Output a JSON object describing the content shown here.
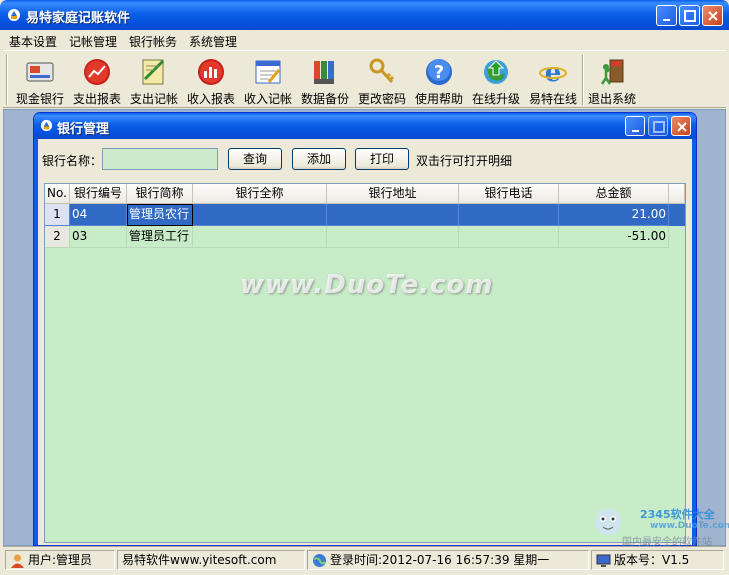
{
  "app": {
    "title": "易特家庭记账软件",
    "menu": [
      "基本设置",
      "记帐管理",
      "银行帐务",
      "系统管理"
    ]
  },
  "toolbar": [
    {
      "label": "现金银行",
      "icon": "cash-bank-icon"
    },
    {
      "label": "支出报表",
      "icon": "expense-report-icon"
    },
    {
      "label": "支出记帐",
      "icon": "expense-entry-icon"
    },
    {
      "label": "收入报表",
      "icon": "income-report-icon"
    },
    {
      "label": "收入记帐",
      "icon": "income-entry-icon"
    },
    {
      "label": "数据备份",
      "icon": "backup-icon"
    },
    {
      "label": "更改密码",
      "icon": "key-icon"
    },
    {
      "label": "使用帮助",
      "icon": "help-icon"
    },
    {
      "label": "在线升级",
      "icon": "upgrade-icon"
    },
    {
      "label": "易特在线",
      "icon": "ie-icon"
    },
    {
      "label": "退出系统",
      "icon": "exit-icon"
    }
  ],
  "bank_window": {
    "title": "银行管理",
    "search_label": "银行名称：",
    "search_value": "",
    "buttons": {
      "query": "查询",
      "add": "添加",
      "print": "打印"
    },
    "hint": "双击行可打开明细",
    "columns": [
      "No.",
      "银行编号",
      "银行简称",
      "银行全称",
      "银行地址",
      "银行电话",
      "总金额"
    ],
    "rows": [
      {
        "no": "1",
        "code": "04",
        "short": "管理员农行",
        "full": "",
        "address": "",
        "phone": "",
        "amount": "21.00",
        "selected": true
      },
      {
        "no": "2",
        "code": "03",
        "short": "管理员工行",
        "full": "",
        "address": "",
        "phone": "",
        "amount": "-51.00",
        "selected": false
      }
    ]
  },
  "watermark": "www.DuoTe.com",
  "status": {
    "user": "用户:管理员",
    "site": "易特软件www.yitesoft.com",
    "login": "登录时间:2012-07-16 16:57:39 星期一",
    "version": "版本号：V1.5"
  },
  "corner_logo": {
    "brand": "2345软件大全",
    "url": "www.DuoTe.com",
    "tagline": "国内最安全的软件站"
  }
}
